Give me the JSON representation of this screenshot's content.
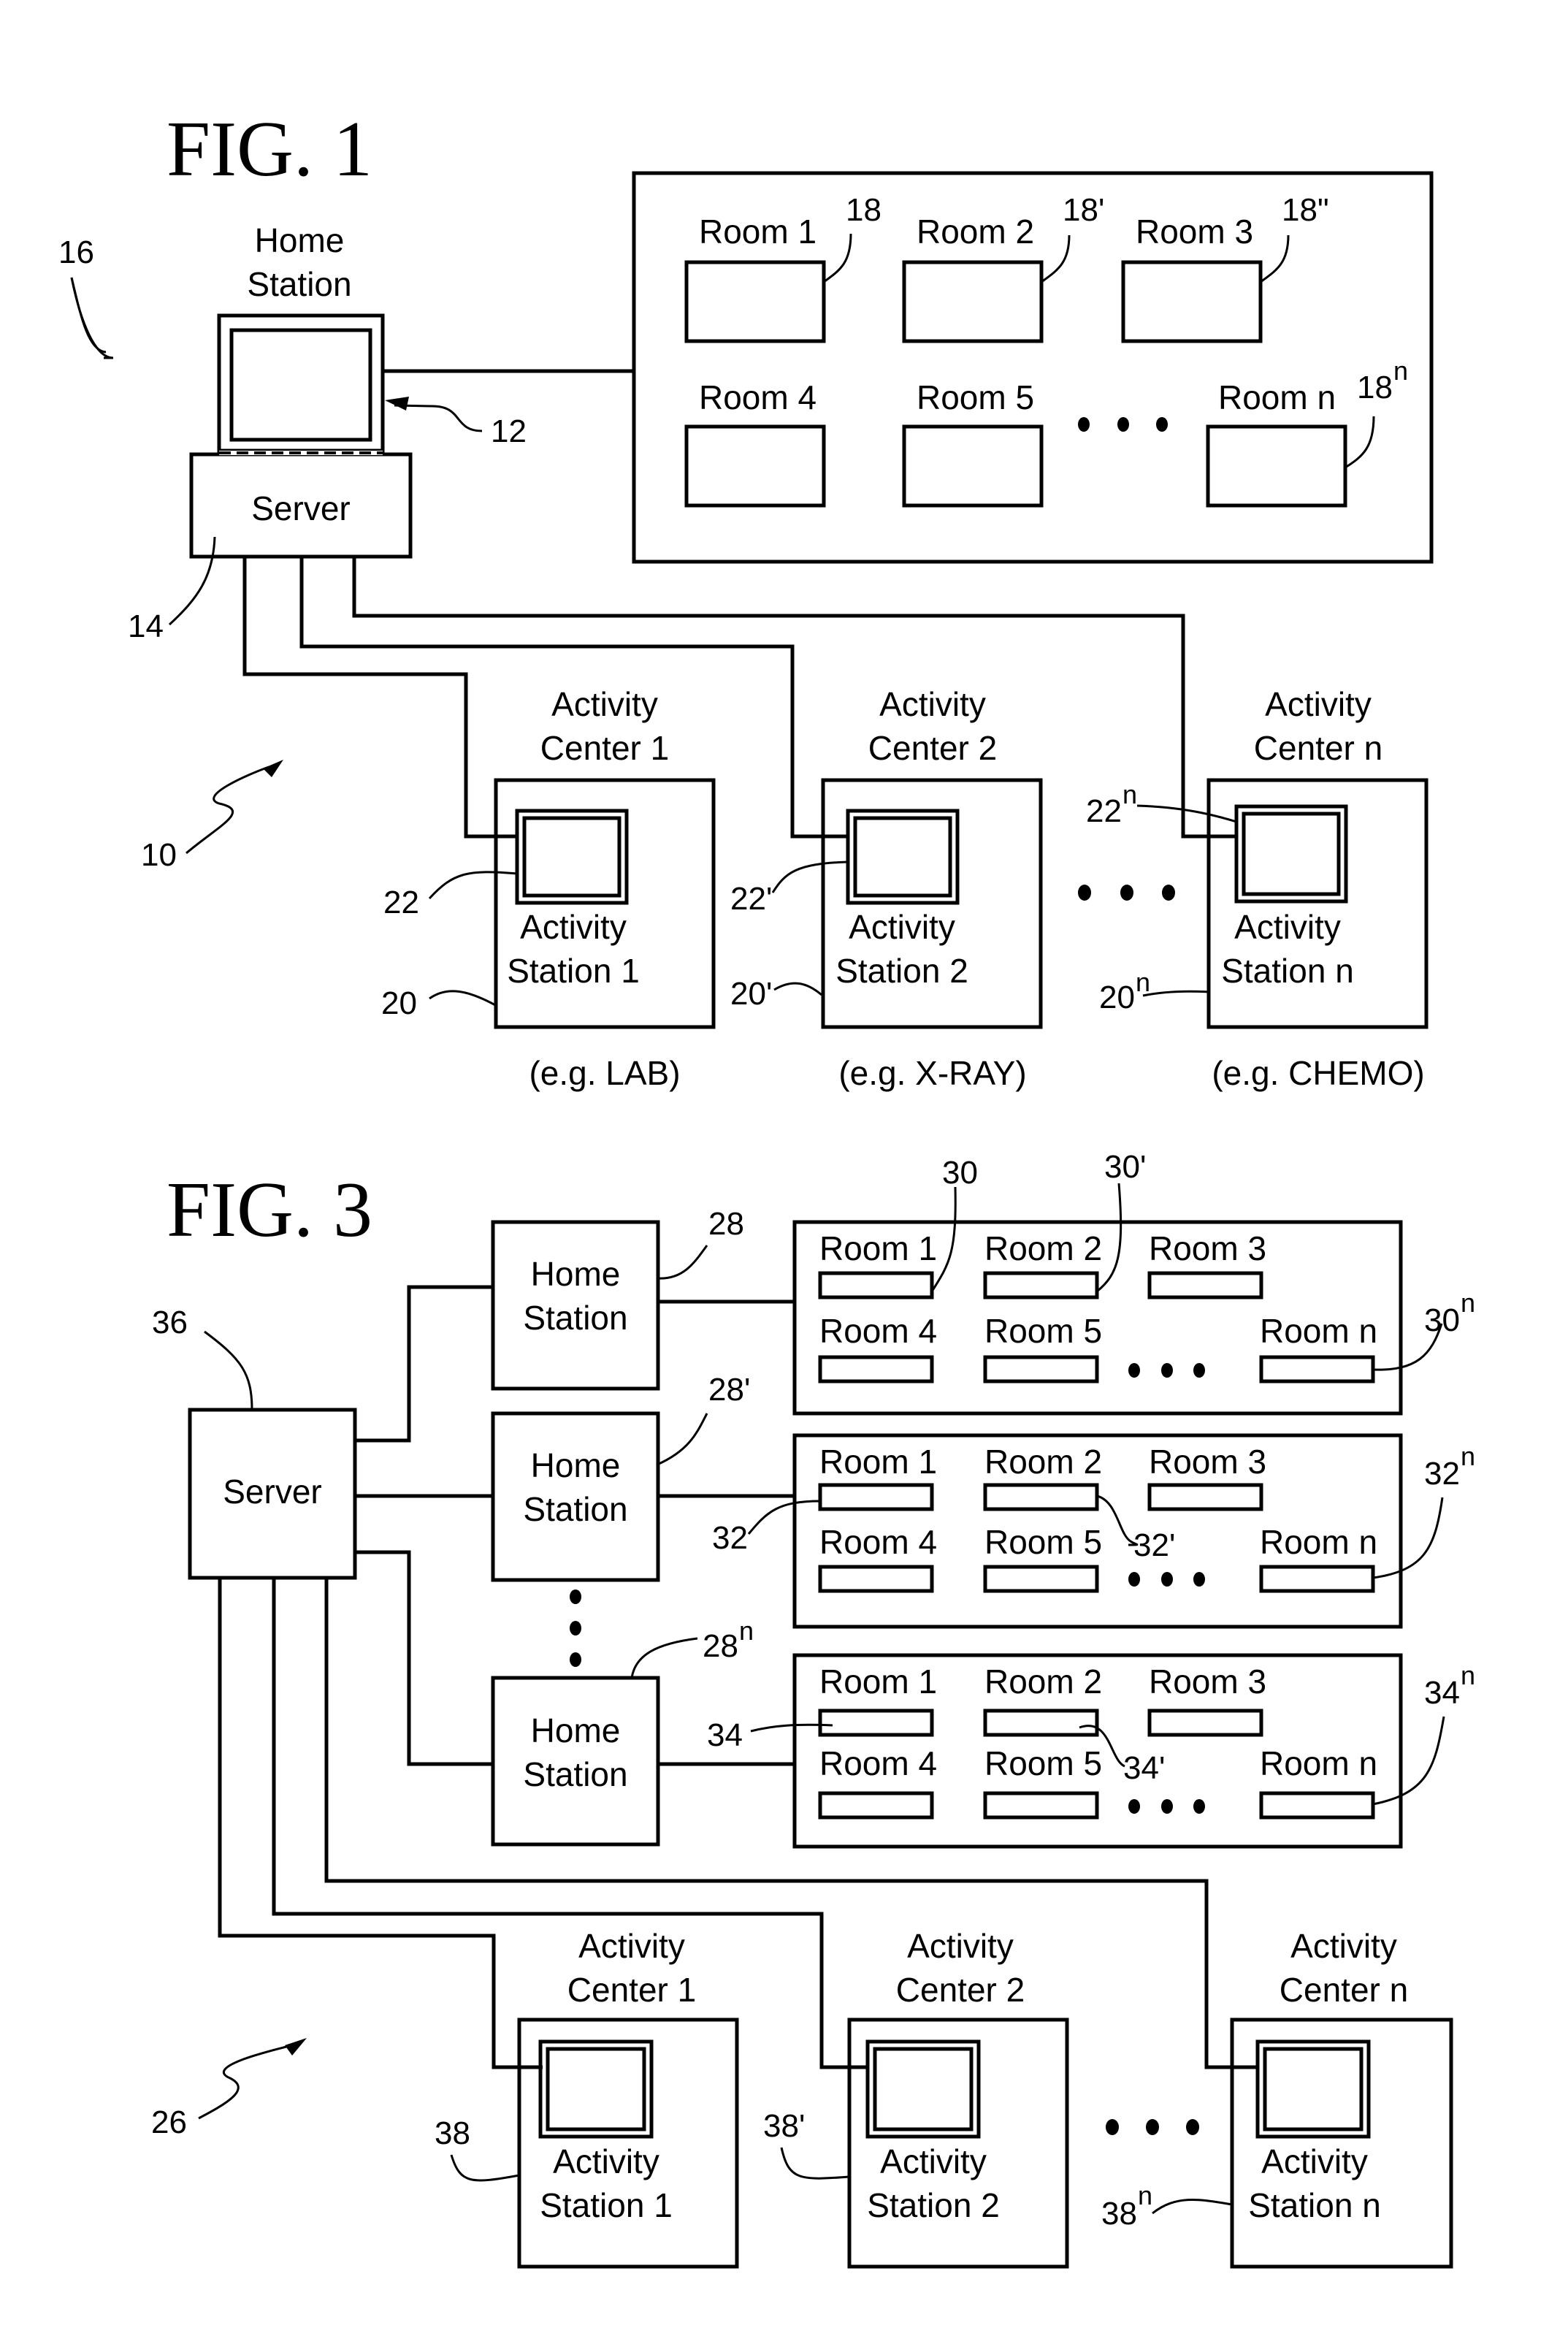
{
  "colors": {
    "ink": "#000000",
    "paper": "#ffffff"
  },
  "fig1": {
    "title": "FIG. 1",
    "home_station": {
      "label_line1": "Home",
      "label_line2": "Station",
      "ref": "16",
      "monitor_ref": "12"
    },
    "server": {
      "label": "Server",
      "ref": "14"
    },
    "system_ref": "10",
    "rooms": [
      {
        "label": "Room 1",
        "ref": "18",
        "sup": ""
      },
      {
        "label": "Room 2",
        "ref": "18'",
        "sup": ""
      },
      {
        "label": "Room 3",
        "ref": "18\"",
        "sup": ""
      },
      {
        "label": "Room 4",
        "ref": "",
        "sup": ""
      },
      {
        "label": "Room 5",
        "ref": "",
        "sup": ""
      },
      {
        "label": "Room n",
        "ref": "18",
        "sup": "n"
      }
    ],
    "activity_centers": [
      {
        "center_line1": "Activity",
        "center_line2": "Center 1",
        "station_line1": "Activity",
        "station_line2": "Station 1",
        "example": "(e.g. LAB)",
        "station_ref": "22",
        "station_sup": "",
        "center_ref": "20",
        "center_sup": ""
      },
      {
        "center_line1": "Activity",
        "center_line2": "Center 2",
        "station_line1": "Activity",
        "station_line2": "Station 2",
        "example": "(e.g. X-RAY)",
        "station_ref": "22'",
        "station_sup": "",
        "center_ref": "20'",
        "center_sup": ""
      },
      {
        "center_line1": "Activity",
        "center_line2": "Center n",
        "station_line1": "Activity",
        "station_line2": "Station n",
        "example": "(e.g. CHEMO)",
        "station_ref": "22",
        "station_sup": "n",
        "center_ref": "20",
        "center_sup": "n"
      }
    ]
  },
  "fig3": {
    "title": "FIG. 3",
    "server": {
      "label": "Server",
      "ref": "36"
    },
    "system_ref": "26",
    "home_stations": [
      {
        "label_line1": "Home",
        "label_line2": "Station",
        "ref": "28",
        "sup": ""
      },
      {
        "label_line1": "Home",
        "label_line2": "Station",
        "ref": "28'",
        "sup": ""
      },
      {
        "label_line1": "Home",
        "label_line2": "Station",
        "ref": "28",
        "sup": "n"
      }
    ],
    "room_groups": [
      {
        "rooms": [
          "Room 1",
          "Room 2",
          "Room 3",
          "Room 4",
          "Room 5",
          "Room n"
        ],
        "ref_a": "30",
        "ref_b": "30'",
        "ref_n": "30",
        "ref_n_sup": "n"
      },
      {
        "rooms": [
          "Room 1",
          "Room 2",
          "Room 3",
          "Room 4",
          "Room 5",
          "Room n"
        ],
        "ref_a": "32",
        "ref_b": "32'",
        "ref_n": "32",
        "ref_n_sup": "n"
      },
      {
        "rooms": [
          "Room 1",
          "Room 2",
          "Room 3",
          "Room 4",
          "Room 5",
          "Room n"
        ],
        "ref_a": "34",
        "ref_b": "34'",
        "ref_n": "34",
        "ref_n_sup": "n"
      }
    ],
    "activity_centers": [
      {
        "center_line1": "Activity",
        "center_line2": "Center 1",
        "station_line1": "Activity",
        "station_line2": "Station 1",
        "ref": "38",
        "sup": ""
      },
      {
        "center_line1": "Activity",
        "center_line2": "Center 2",
        "station_line1": "Activity",
        "station_line2": "Station 2",
        "ref": "38'",
        "sup": ""
      },
      {
        "center_line1": "Activity",
        "center_line2": "Center n",
        "station_line1": "Activity",
        "station_line2": "Station n",
        "ref": "38",
        "sup": "n"
      }
    ]
  }
}
